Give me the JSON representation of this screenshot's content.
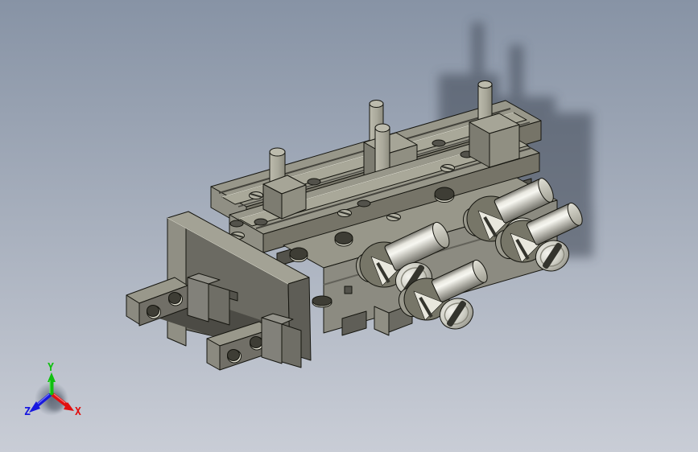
{
  "viewport": {
    "description": "Shaded isometric CAD view of a dual-rail parallel clamp / gripper assembly with cast shadow",
    "render_style": "shaded-with-edges",
    "background": {
      "top": "#8793a5",
      "bottom": "#c9cdd6"
    }
  },
  "palette": {
    "face-top": "#98978a",
    "face-top-bright": "#a9a899",
    "face-left": "#908f84",
    "face-front": "#767468",
    "face-front-dark": "#6b6a62",
    "face-right": "#8c8b81",
    "block-top": "#a6a597",
    "block-front": "#908f82",
    "block-left": "#7d7c71",
    "recess": "#53524b",
    "recess-dark": "#4c4b45",
    "edge": "#15150f",
    "hole-dark": "#3e3d35",
    "hole-light": "#dcdbcc",
    "slot": "#34342d",
    "shadow": "#39404e"
  },
  "model": {
    "name": "parallel-clamp-assembly",
    "parts": [
      {
        "name": "back-slide-rail",
        "count": 1
      },
      {
        "name": "front-slide-rail",
        "count": 1
      },
      {
        "name": "guide-pin",
        "count": 4
      },
      {
        "name": "pin-carrier-block",
        "count": 3
      },
      {
        "name": "main-body",
        "count": 1
      },
      {
        "name": "swivel-screw-clamp",
        "count": 4
      },
      {
        "name": "cross-beam",
        "count": 1
      },
      {
        "name": "arm-plate",
        "count": 2,
        "holes_per_plate": 2
      },
      {
        "name": "jaw-finger-block",
        "count": 2
      },
      {
        "name": "support-foot",
        "count": 2
      }
    ]
  },
  "triad": {
    "axes": [
      {
        "label": "X",
        "color": "#e01010",
        "direction": "lower-right"
      },
      {
        "label": "Y",
        "color": "#10c010",
        "direction": "up"
      },
      {
        "label": "Z",
        "color": "#1818e0",
        "direction": "lower-left"
      }
    ]
  }
}
